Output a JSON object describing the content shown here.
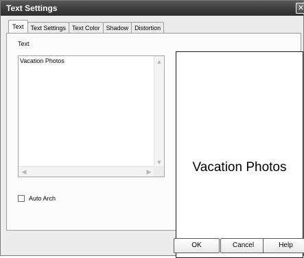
{
  "window": {
    "title": "Text Settings",
    "close_glyph": "✕"
  },
  "tabs": [
    {
      "label": "Text",
      "active": true
    },
    {
      "label": "Text Settings",
      "active": false
    },
    {
      "label": "Text Color",
      "active": false
    },
    {
      "label": "Shadow",
      "active": false
    },
    {
      "label": "Distortion",
      "active": false
    }
  ],
  "text_panel": {
    "label": "Text",
    "value": "Vacation Photos",
    "auto_arch": {
      "label": "Auto Arch",
      "checked": false
    }
  },
  "preview": {
    "text": "Vacation Photos"
  },
  "buttons": {
    "ok": "OK",
    "cancel": "Cancel",
    "help": "Help"
  },
  "icons": {
    "scroll_up": "chevron-up-icon",
    "scroll_down": "chevron-down-icon",
    "scroll_left": "chevron-left-icon",
    "scroll_right": "chevron-right-icon",
    "close": "close-icon"
  }
}
